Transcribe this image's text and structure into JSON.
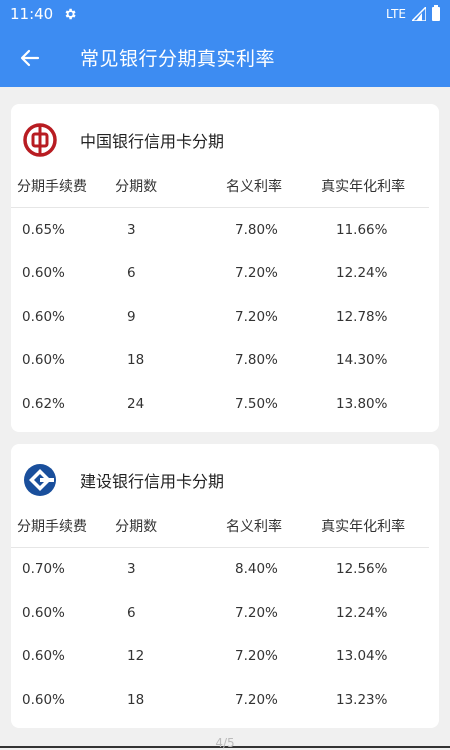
{
  "status": {
    "time": "11:40",
    "network": "LTE",
    "icons": [
      "gear-icon",
      "signal-icon",
      "battery-icon"
    ]
  },
  "header": {
    "title": "常见银行分期真实利率",
    "back_icon": "arrow-left-icon"
  },
  "columns": [
    "分期手续费",
    "分期数",
    "名义利率",
    "真实年化利率"
  ],
  "cards": [
    {
      "bank": "中国银行信用卡分期",
      "logo": "boc-logo",
      "logo_color": "#b81c22",
      "rows": [
        [
          "0.65%",
          "3",
          "7.80%",
          "11.66%"
        ],
        [
          "0.60%",
          "6",
          "7.20%",
          "12.24%"
        ],
        [
          "0.60%",
          "9",
          "7.20%",
          "12.78%"
        ],
        [
          "0.60%",
          "18",
          "7.80%",
          "14.30%"
        ],
        [
          "0.62%",
          "24",
          "7.50%",
          "13.80%"
        ]
      ]
    },
    {
      "bank": "建设银行信用卡分期",
      "logo": "ccb-logo",
      "logo_color": "#1a4f9c",
      "rows": [
        [
          "0.70%",
          "3",
          "8.40%",
          "12.56%"
        ],
        [
          "0.60%",
          "6",
          "7.20%",
          "12.24%"
        ],
        [
          "0.60%",
          "12",
          "7.20%",
          "13.04%"
        ],
        [
          "0.60%",
          "18",
          "7.20%",
          "13.23%"
        ]
      ]
    }
  ],
  "page_indicator": "4/5",
  "colors": {
    "primary": "#3d8cf2",
    "background": "#f0f0f0"
  }
}
